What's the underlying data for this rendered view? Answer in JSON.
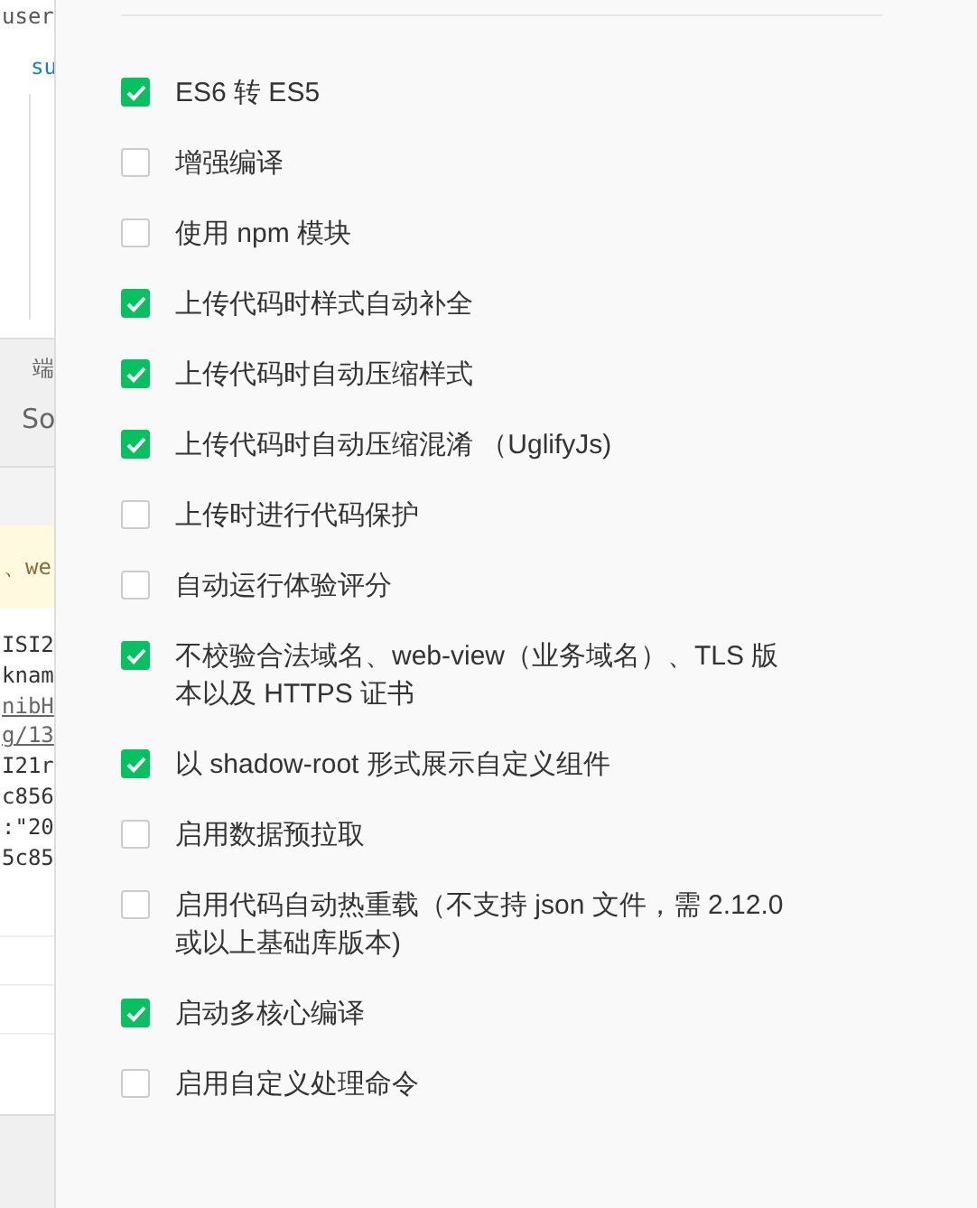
{
  "editor_strip": {
    "code_top": [
      "user",
      "su"
    ],
    "tab_label": "端",
    "tab_button": "So",
    "notice": "、we",
    "code_lines": [
      "ISI2",
      "knam",
      "nibH",
      "g/13",
      "I21r",
      "c856",
      ":\"20",
      "5c85"
    ]
  },
  "settings": [
    {
      "label": "ES6 转 ES5",
      "checked": true
    },
    {
      "label": "增强编译",
      "checked": false
    },
    {
      "label": "使用 npm 模块",
      "checked": false
    },
    {
      "label": "上传代码时样式自动补全",
      "checked": true
    },
    {
      "label": "上传代码时自动压缩样式",
      "checked": true
    },
    {
      "label": "上传代码时自动压缩混淆 （UglifyJs)",
      "checked": true
    },
    {
      "label": "上传时进行代码保护",
      "checked": false
    },
    {
      "label": "自动运行体验评分",
      "checked": false
    },
    {
      "label": "不校验合法域名、web-view（业务域名）、TLS 版本以及 HTTPS 证书",
      "checked": true
    },
    {
      "label": "以 shadow-root 形式展示自定义组件",
      "checked": true
    },
    {
      "label": "启用数据预拉取",
      "checked": false
    },
    {
      "label": "启用代码自动热重载（不支持 json 文件，需 2.12.0 或以上基础库版本)",
      "checked": false
    },
    {
      "label": "启动多核心编译",
      "checked": true
    },
    {
      "label": "启用自定义处理命令",
      "checked": false
    }
  ]
}
